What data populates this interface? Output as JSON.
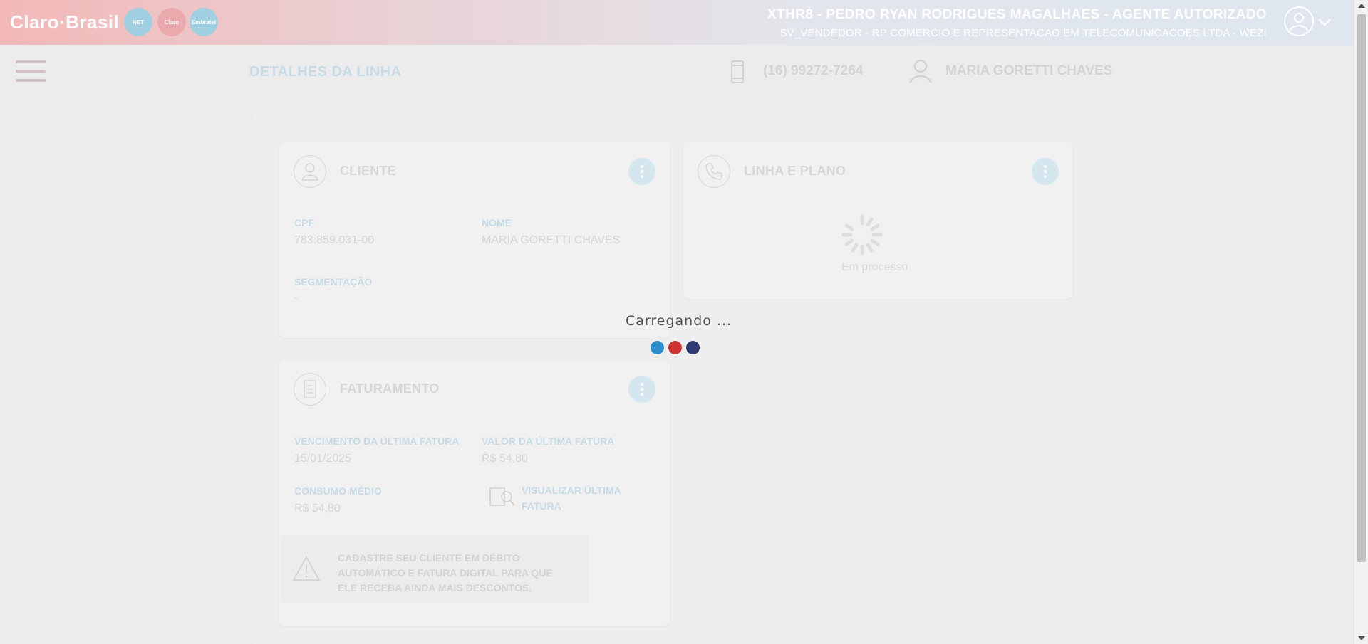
{
  "header": {
    "logo_text": "Claro·Brasil",
    "badges": [
      "NET",
      "Claro",
      "Embratel"
    ],
    "agent_line1": "XTHR8 - PEDRO RYAN RODRIGUES MAGALHAES - AGENTE AUTORIZADO",
    "agent_line2": "SV_VENDEDOR - RP COMERCIO E REPRESENTACAO EM TELECOMUNICACOES LTDA - WEZI"
  },
  "subheader": {
    "page_title": "DETALHES DA LINHA",
    "phone": "(16) 99272-7264",
    "customer_name": "MARIA GORETTI CHAVES"
  },
  "cliente": {
    "title": "CLIENTE",
    "cpf_label": "CPF",
    "cpf_value": "783.859.031-00",
    "nome_label": "NOME",
    "nome_value": "MARIA GORETTI CHAVES",
    "seg_label": "SEGMENTAÇÃO",
    "seg_value": "-"
  },
  "linha": {
    "title": "LINHA E PLANO",
    "processing_text": "Em processo"
  },
  "faturamento": {
    "title": "FATURAMENTO",
    "venc_label": "VENCIMENTO DA ÚLTIMA FATURA",
    "venc_value": "15/01/2025",
    "valor_label": "VALOR DA ÚLTIMA FATURA",
    "valor_value": "R$ 54,80",
    "consumo_label": "CONSUMO MÉDIO",
    "consumo_value": "R$ 54,80",
    "view_invoice_label": "VISUALIZAR ÚLTIMA FATURA",
    "warning_text": "CADASTRE SEU CLIENTE EM DÉBITO AUTOMÁTICO E FATURA DIGITAL PARA QUE ELE RECEBA AINDA MAIS DESCONTOS."
  },
  "loading": {
    "text": "Carregando ...",
    "dot_colors": [
      "#2c8fcb",
      "#cc3333",
      "#2f3a73"
    ]
  }
}
